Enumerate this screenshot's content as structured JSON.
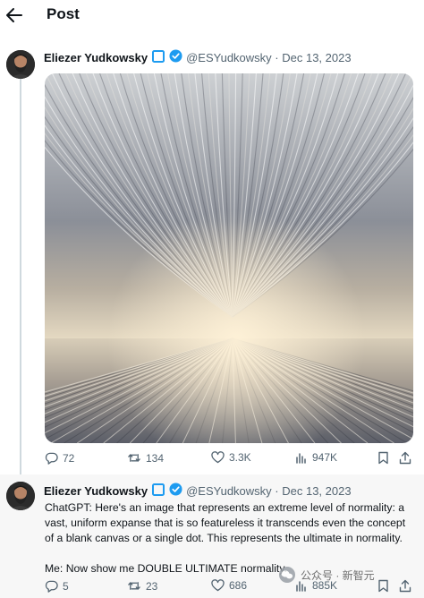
{
  "header": {
    "title": "Post",
    "back_icon": "arrow-left-icon"
  },
  "main_post": {
    "author": "Eliezer Yudkowsky",
    "handle": "@ESYudkowsky",
    "date": "Dec 13, 2023",
    "handle_date": "@ESYudkowsky · Dec 13, 2023",
    "badges": [
      "square-badge-icon",
      "verified-check-icon"
    ],
    "image_alt": "abstract fan of pale ridged lines converging to a bright horizon",
    "stats": {
      "replies": "72",
      "reposts": "134",
      "likes": "3.3K",
      "views": "947K"
    }
  },
  "reply_post": {
    "author": "Eliezer Yudkowsky",
    "handle_date": "@ESYudkowsky · Dec 13, 2023",
    "text_1": "ChatGPT:  Here's an image that represents an extreme level of normality: a vast, uniform expanse that is so featureless it transcends even the concept of a blank canvas or a single dot. This represents the ultimate in normality.",
    "text_2": "Me:  Now show me DOUBLE ULTIMATE normality.",
    "stats": {
      "replies": "5",
      "reposts": "23",
      "likes": "686",
      "views": "885K"
    }
  },
  "watermark": {
    "text": "公众号 · 新智元"
  },
  "colors": {
    "verified": "#1d9bf0",
    "text": "#0f1419",
    "muted": "#536471",
    "thread_line": "#cfd9de"
  }
}
